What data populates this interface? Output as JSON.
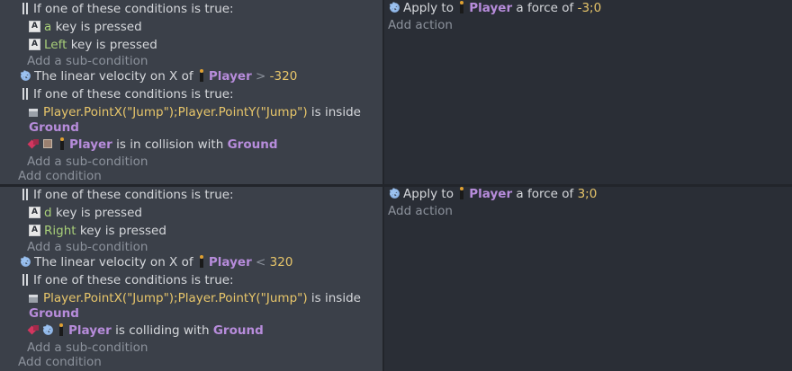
{
  "events": [
    {
      "conditions": {
        "or1": {
          "label": "If one of these conditions is true:"
        },
        "c1": {
          "key": "a",
          "text": "key is pressed"
        },
        "c2": {
          "key": "Left",
          "text": "key is pressed"
        },
        "add_sub": "Add a sub-condition",
        "vel": {
          "pre": "The linear velocity on X of",
          "object": "Player",
          "op": ">",
          "value": "-320"
        },
        "or2": {
          "label": "If one of these conditions is true:"
        },
        "inside": {
          "expr": "Player.PointX(\"Jump\");Player.PointY(\"Jump\")",
          "text": "is inside",
          "object": "Ground"
        },
        "coll": {
          "object": "Player",
          "text": "is in collision with",
          "target": "Ground"
        },
        "add_sub2": "Add a sub-condition",
        "add_cond": "Add condition"
      },
      "actions": {
        "a1": {
          "pre": "Apply to",
          "object": "Player",
          "mid": "a force of",
          "value": "-3;0"
        },
        "add_action": "Add action"
      }
    },
    {
      "conditions": {
        "or1": {
          "label": "If one of these conditions is true:"
        },
        "c1": {
          "key": "d",
          "text": "key is pressed"
        },
        "c2": {
          "key": "Right",
          "text": "key is pressed"
        },
        "add_sub": "Add a sub-condition",
        "vel": {
          "pre": "The linear velocity on X of",
          "object": "Player",
          "op": "<",
          "value": "320"
        },
        "or2": {
          "label": "If one of these conditions is true:"
        },
        "inside": {
          "expr": "Player.PointX(\"Jump\");Player.PointY(\"Jump\")",
          "text": "is inside",
          "object": "Ground"
        },
        "coll": {
          "object": "Player",
          "text": "is colliding with",
          "target": "Ground"
        },
        "add_sub2": "Add a sub-condition",
        "add_cond": "Add condition"
      },
      "actions": {
        "a1": {
          "pre": "Apply to",
          "object": "Player",
          "mid": "a force of",
          "value": "3;0"
        },
        "add_action": "Add action"
      }
    }
  ]
}
